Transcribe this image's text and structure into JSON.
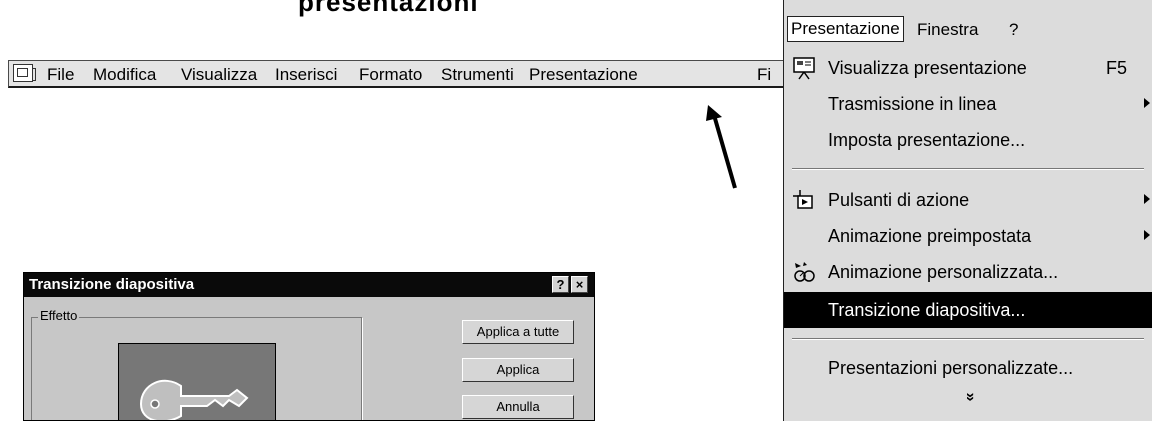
{
  "heading_fragment": "presentazioni",
  "menubar": {
    "items": [
      "File",
      "Modifica",
      "Visualizza",
      "Inserisci",
      "Formato",
      "Strumenti",
      "Presentazione",
      "Fi"
    ]
  },
  "menu": {
    "headers": [
      "Presentazione",
      "Finestra",
      "?"
    ],
    "items": [
      {
        "label": "Visualizza presentazione",
        "shortcut": "F5"
      },
      {
        "label": "Trasmissione in linea"
      },
      {
        "label": "Imposta presentazione..."
      },
      {
        "label": "Pulsanti di azione"
      },
      {
        "label": "Animazione preimpostata"
      },
      {
        "label": "Animazione personalizzata..."
      },
      {
        "label": "Transizione diapositiva..."
      },
      {
        "label": "Presentazioni personalizzate..."
      }
    ],
    "expand_glyph": "»"
  },
  "dialog": {
    "title": "Transizione diapositiva",
    "help_btn": "?",
    "close_btn": "×",
    "group_label": "Effetto",
    "buttons": [
      "Applica a tutte",
      "Applica",
      "Annulla"
    ]
  },
  "colors": {
    "menu_bg": "#dcdcdc",
    "selected_bg": "#000000",
    "dialog_bg": "#c7c7c7",
    "title_bar": "#0a0a0a"
  }
}
